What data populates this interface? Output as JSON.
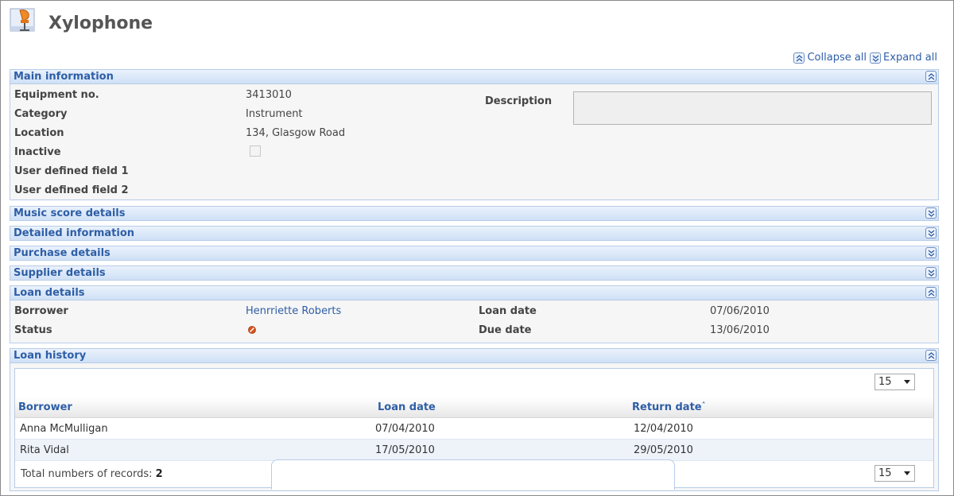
{
  "page": {
    "title": "Xylophone"
  },
  "toolbar": {
    "collapse_all": "Collapse all",
    "expand_all": "Expand all"
  },
  "main_info": {
    "header": "Main information",
    "labels": {
      "equipment_no": "Equipment no.",
      "category": "Category",
      "location": "Location",
      "inactive": "Inactive",
      "udf1": "User defined field 1",
      "udf2": "User defined field 2",
      "description": "Description"
    },
    "values": {
      "equipment_no": "3413010",
      "category": "Instrument",
      "location": "134, Glasgow Road",
      "udf1": "",
      "udf2": "",
      "description": ""
    },
    "inactive_checked": false
  },
  "sections": {
    "music_score": "Music score details",
    "detailed_info": "Detailed information",
    "purchase": "Purchase details",
    "supplier": "Supplier details"
  },
  "loan_details": {
    "header": "Loan details",
    "labels": {
      "borrower": "Borrower",
      "status": "Status",
      "loan_date": "Loan date",
      "due_date": "Due date"
    },
    "values": {
      "borrower": "Henrriette Roberts",
      "loan_date": "07/06/2010",
      "due_date": "13/06/2010"
    },
    "status_icon": "overdue-status-icon"
  },
  "loan_history": {
    "header": "Loan history",
    "page_size": "15",
    "columns": [
      "Borrower",
      "Loan date",
      "Return date"
    ],
    "sort_indicator": "˄",
    "rows": [
      {
        "borrower": "Anna McMulligan",
        "loan_date": "07/04/2010",
        "return_date": "12/04/2010"
      },
      {
        "borrower": "Rita Vidal",
        "loan_date": "17/05/2010",
        "return_date": "29/05/2010"
      }
    ],
    "total_label": "Total numbers of records:",
    "total_value": "2"
  },
  "colors": {
    "link": "#2e5ea6",
    "header_gradient_top": "#eaf2fc",
    "header_gradient_bottom": "#cfe0f6",
    "border": "#b7cce7"
  }
}
